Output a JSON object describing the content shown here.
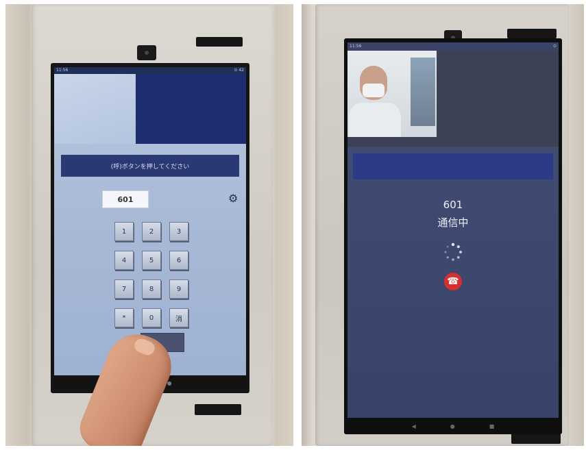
{
  "left_photo": {
    "status_time": "11:56",
    "status_right": "⊙ 42",
    "instruction_banner": "(呼)ボタンを押してください",
    "room_number_display": "601",
    "keypad_keys": [
      "1",
      "2",
      "3",
      "4",
      "5",
      "6",
      "7",
      "8",
      "9",
      "*",
      "0",
      "消"
    ],
    "nav_icons": [
      "◀",
      "●"
    ],
    "icons": {
      "settings": "gear-icon"
    }
  },
  "right_photo": {
    "status_time": "11:56",
    "status_right": "⊙",
    "call_number": "601",
    "call_status": "通信中",
    "nav_icons": [
      "◀",
      "●",
      "■"
    ],
    "colors": {
      "hangup": "#d3302f",
      "banner": "#2d3a87"
    },
    "icons": {
      "hangup": "hangup-phone-icon",
      "loading": "spinner-icon"
    }
  }
}
